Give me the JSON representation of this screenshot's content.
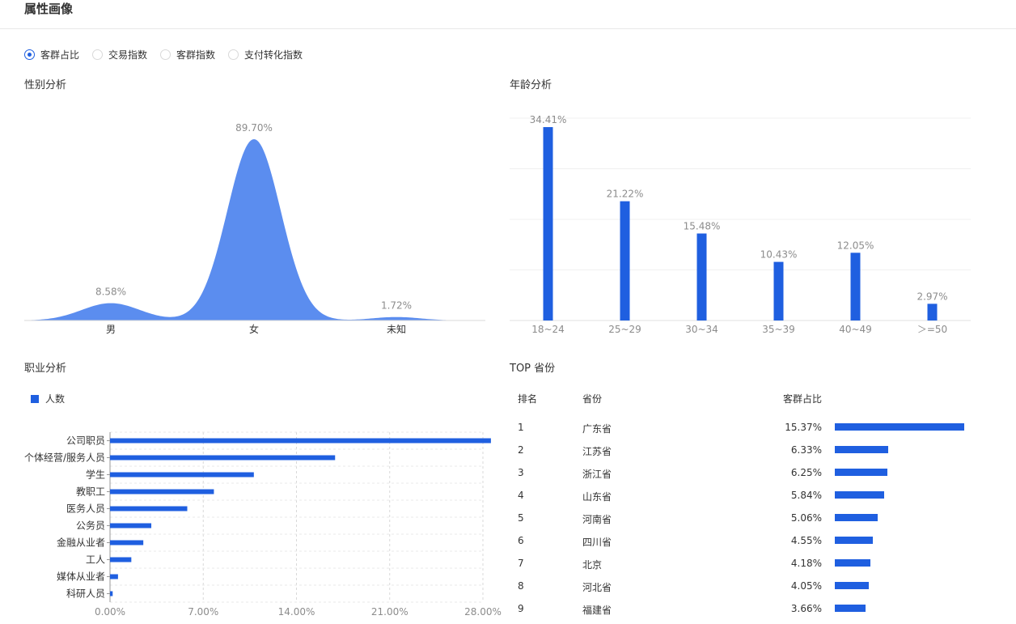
{
  "page_title": "属性画像",
  "radio_options": [
    {
      "label": "客群占比",
      "checked": true
    },
    {
      "label": "交易指数",
      "checked": false
    },
    {
      "label": "客群指数",
      "checked": false
    },
    {
      "label": "支付转化指数",
      "checked": false
    }
  ],
  "colors": {
    "accent": "#1f5fe0",
    "area": "#5b8def",
    "label_gray": "#8c8c8c"
  },
  "sections": {
    "gender": "性别分析",
    "age": "年龄分析",
    "occupation": "职业分析",
    "province": "TOP 省份"
  },
  "chart_data": [
    {
      "type": "area",
      "categories": [
        "男",
        "女",
        "未知"
      ],
      "values": [
        8.58,
        89.7,
        1.72
      ],
      "value_labels": [
        "8.58%",
        "89.70%",
        "1.72%"
      ],
      "grid": false
    },
    {
      "type": "bar",
      "categories": [
        "18~24",
        "25~29",
        "30~34",
        "35~39",
        "40~49",
        "＞=50"
      ],
      "values": [
        34.41,
        21.22,
        15.48,
        10.43,
        12.05,
        2.97
      ],
      "value_labels": [
        "34.41%",
        "21.22%",
        "15.48%",
        "10.43%",
        "12.05%",
        "2.97%"
      ],
      "ylim": [
        0,
        36
      ],
      "grid": true
    },
    {
      "type": "bar",
      "orientation": "horizontal",
      "legend": "人数",
      "legend_position": "top-left",
      "categories": [
        "公司职员",
        "个体经营/服务人员",
        "学生",
        "教职工",
        "医务人员",
        "公务员",
        "金融从业者",
        "工人",
        "媒体从业者",
        "科研人员"
      ],
      "values": [
        28.6,
        16.9,
        10.8,
        7.8,
        5.8,
        3.1,
        2.5,
        1.6,
        0.6,
        0.2
      ],
      "xlim": [
        0,
        28
      ],
      "xticks": [
        0,
        7,
        14,
        21,
        28
      ],
      "xtick_labels": [
        "0.00%",
        "7.00%",
        "14.00%",
        "21.00%",
        "28.00%"
      ],
      "grid": true
    }
  ],
  "province_table": {
    "headers": {
      "rank": "排名",
      "province": "省份",
      "share": "客群占比"
    },
    "rows": [
      {
        "rank": "1",
        "province": "广东省",
        "share": "15.37%",
        "value": 15.37
      },
      {
        "rank": "2",
        "province": "江苏省",
        "share": "6.33%",
        "value": 6.33
      },
      {
        "rank": "3",
        "province": "浙江省",
        "share": "6.25%",
        "value": 6.25
      },
      {
        "rank": "4",
        "province": "山东省",
        "share": "5.84%",
        "value": 5.84
      },
      {
        "rank": "5",
        "province": "河南省",
        "share": "5.06%",
        "value": 5.06
      },
      {
        "rank": "6",
        "province": "四川省",
        "share": "4.55%",
        "value": 4.55
      },
      {
        "rank": "7",
        "province": "北京",
        "share": "4.18%",
        "value": 4.18
      },
      {
        "rank": "8",
        "province": "河北省",
        "share": "4.05%",
        "value": 4.05
      },
      {
        "rank": "9",
        "province": "福建省",
        "share": "3.66%",
        "value": 3.66
      }
    ]
  }
}
